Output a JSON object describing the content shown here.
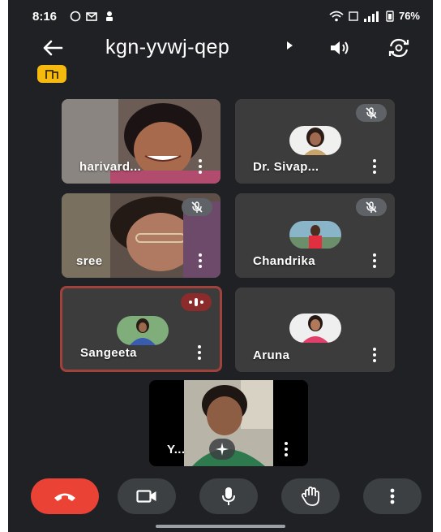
{
  "status_bar": {
    "time": "8:16",
    "battery": "76%"
  },
  "header": {
    "meeting_code": "kgn-yvwj-qep"
  },
  "participants": [
    {
      "name": "harivard...",
      "mic": "on",
      "video": true
    },
    {
      "name": "Dr. Sivap...",
      "mic": "muted",
      "video": false
    },
    {
      "name": "sree",
      "mic": "muted",
      "video": true
    },
    {
      "name": "Chandrika",
      "mic": "muted",
      "video": false
    },
    {
      "name": "Sangeeta",
      "mic": "speaking",
      "video": false
    },
    {
      "name": "Aruna",
      "mic": "on",
      "video": false
    }
  ],
  "self_view": {
    "name": "Y..."
  },
  "controls": {
    "end_call": "end-call-icon",
    "camera": "video-camera-icon",
    "microphone": "microphone-icon",
    "raise_hand": "raise-hand-icon",
    "more": "more-vertical-icon"
  },
  "colors": {
    "background": "#202124",
    "tile": "#3c3c3c",
    "end_call": "#ea4335",
    "control": "#3c4043",
    "speaking_border": "#a0413c",
    "badge": "#f5b90f"
  }
}
